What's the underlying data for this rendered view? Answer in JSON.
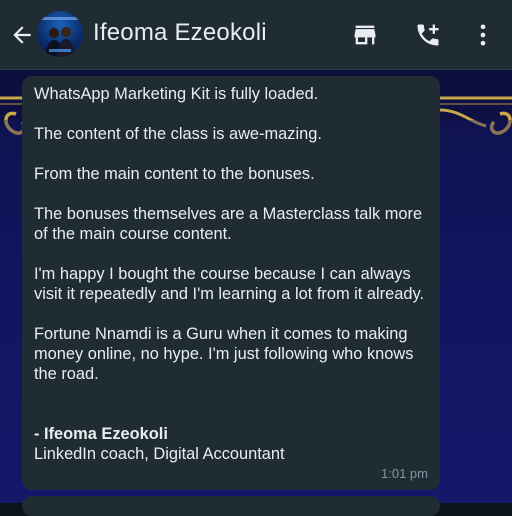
{
  "header": {
    "contact_name": "Ifeoma Ezeokoli",
    "icons": [
      "back-arrow-icon",
      "avatar",
      "store-icon",
      "call-add-icon",
      "more-vertical-icon"
    ]
  },
  "message": {
    "paragraphs": [
      "WhatsApp Marketing Kit is fully loaded.",
      "The content of the class is awe-mazing.",
      "From the main content to the bonuses.",
      "The bonuses themselves are a Masterclass talk more of the main course content.",
      "I'm happy I bought the course because I can always visit it repeatedly and I'm learning a lot from it already.",
      "Fortune Nnamdi is a Guru when it comes to making money online, no hype. I'm just following who knows the road."
    ],
    "signature_name": "- Ifeoma Ezeokoli",
    "signature_role": "LinkedIn coach, Digital Accountant",
    "time": "1:01 pm"
  },
  "colors": {
    "header_bg": "#1f2c34",
    "bubble_bg": "#1f2c34",
    "text": "#e9edef",
    "meta_text": "#8696a0",
    "wallpaper": "#12145a",
    "wallpaper_ornament": "#c9a64a"
  }
}
